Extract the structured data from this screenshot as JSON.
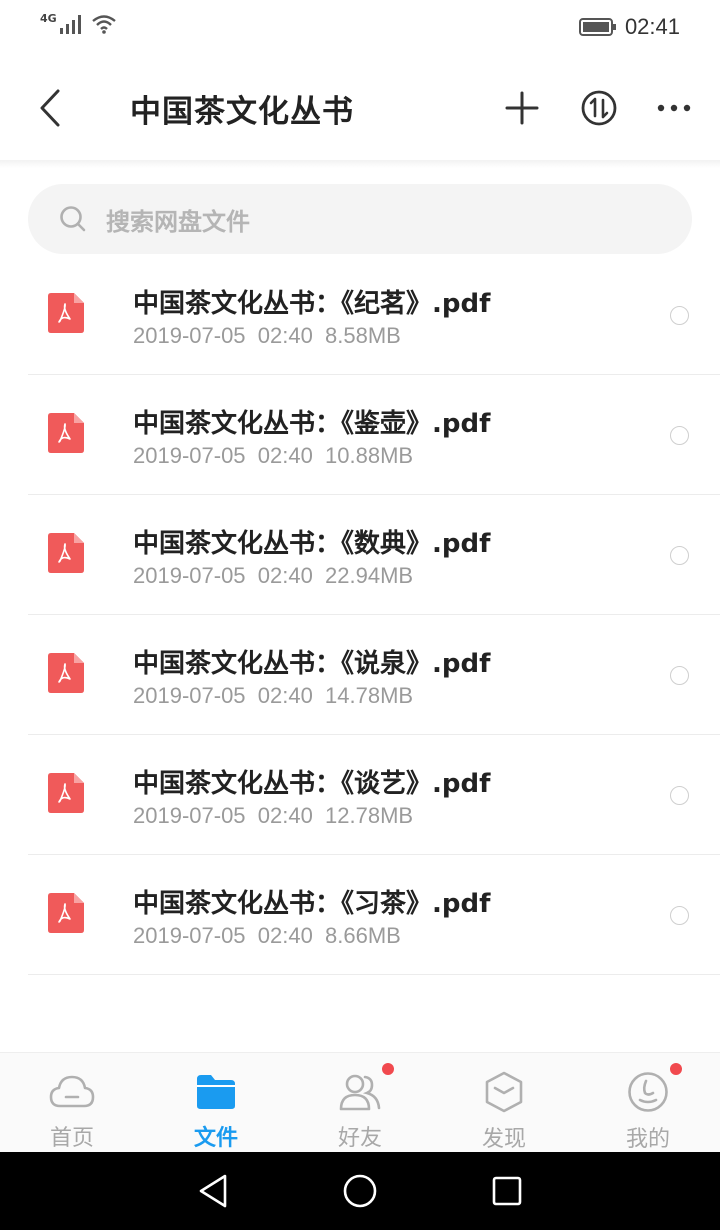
{
  "status_bar": {
    "network": "4G",
    "time": "02:41"
  },
  "header": {
    "title": "中国茶文化丛书"
  },
  "search": {
    "placeholder": "搜索网盘文件"
  },
  "files": [
    {
      "name": "中国茶文化丛书：《纪茗》.pdf",
      "meta": "2019-07-05  02:40  8.58MB"
    },
    {
      "name": "中国茶文化丛书：《鉴壶》.pdf",
      "meta": "2019-07-05  02:40  10.88MB"
    },
    {
      "name": "中国茶文化丛书：《数典》.pdf",
      "meta": "2019-07-05  02:40  22.94MB"
    },
    {
      "name": "中国茶文化丛书：《说泉》.pdf",
      "meta": "2019-07-05  02:40  14.78MB"
    },
    {
      "name": "中国茶文化丛书：《谈艺》.pdf",
      "meta": "2019-07-05  02:40  12.78MB"
    },
    {
      "name": "中国茶文化丛书：《习茶》.pdf",
      "meta": "2019-07-05  02:40  8.66MB"
    }
  ],
  "tabs": [
    {
      "label": "首页",
      "icon": "cloud-icon"
    },
    {
      "label": "文件",
      "icon": "folder-icon"
    },
    {
      "label": "好友",
      "icon": "friends-icon"
    },
    {
      "label": "发现",
      "icon": "discover-icon"
    },
    {
      "label": "我的",
      "icon": "profile-icon"
    }
  ],
  "colors": {
    "accent": "#1a9bf0",
    "pdf": "#f05a5a",
    "badge": "#f1494e"
  }
}
